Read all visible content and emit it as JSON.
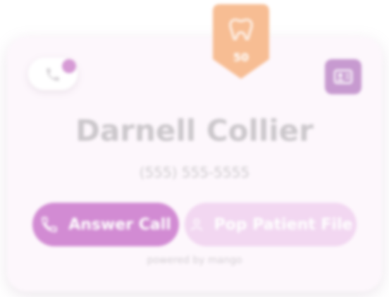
{
  "badge": {
    "count": "50",
    "icon": "tooth-icon",
    "color": "#f7bd93"
  },
  "call_indicator": {
    "icon": "phone-icon"
  },
  "caller": {
    "name": "Darnell Collier",
    "phone": "(555) 555-5555"
  },
  "actions": {
    "answer_label": "Answer Call",
    "answer_icon": "phone-icon",
    "patient_label": "Pop Patient File",
    "patient_icon": "user-icon"
  },
  "footer": {
    "powered_by": "powered by mango"
  },
  "colors": {
    "accent": "#d28bd3",
    "accent_light": "#f2d7f1",
    "card_bg": "#fdf7fc"
  }
}
